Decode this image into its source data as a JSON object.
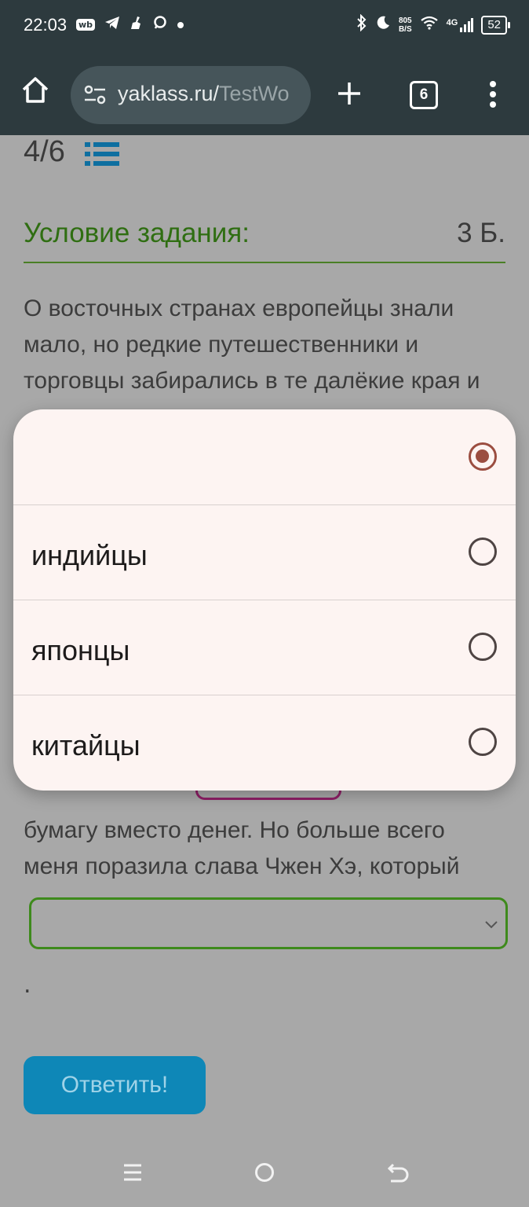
{
  "status_bar": {
    "time": "22:03",
    "left_icons": [
      "wb-icon",
      "telegram-icon",
      "broom-icon",
      "chat-icon",
      "dot-icon"
    ],
    "speed_value": "805",
    "speed_unit": "B/S",
    "network": "4G",
    "battery": "52"
  },
  "browser": {
    "url_main": "yaklass.ru/",
    "url_rest": "TestWo",
    "tab_count": "6"
  },
  "page": {
    "counter": "4/6",
    "task_title": "Условие задания:",
    "points": "3 Б.",
    "para1": "О восточных странах европейцы знали мало, но редкие путешественники и торговцы забирались в те далёкие края и",
    "para2": "бумагу вместо денег. Но больше всего меня поразила слава Чжен Хэ, который",
    "period": ".",
    "answer_button": "Ответить!"
  },
  "popup": {
    "options": [
      {
        "label": "",
        "selected": true
      },
      {
        "label": "индийцы",
        "selected": false
      },
      {
        "label": "японцы",
        "selected": false
      },
      {
        "label": "китайцы",
        "selected": false
      }
    ]
  },
  "colors": {
    "accent_green": "#2f6e12",
    "button_blue": "#0e87b7",
    "radio_selected": "#9b4d40",
    "chrome_bg": "#2d3a3e"
  }
}
